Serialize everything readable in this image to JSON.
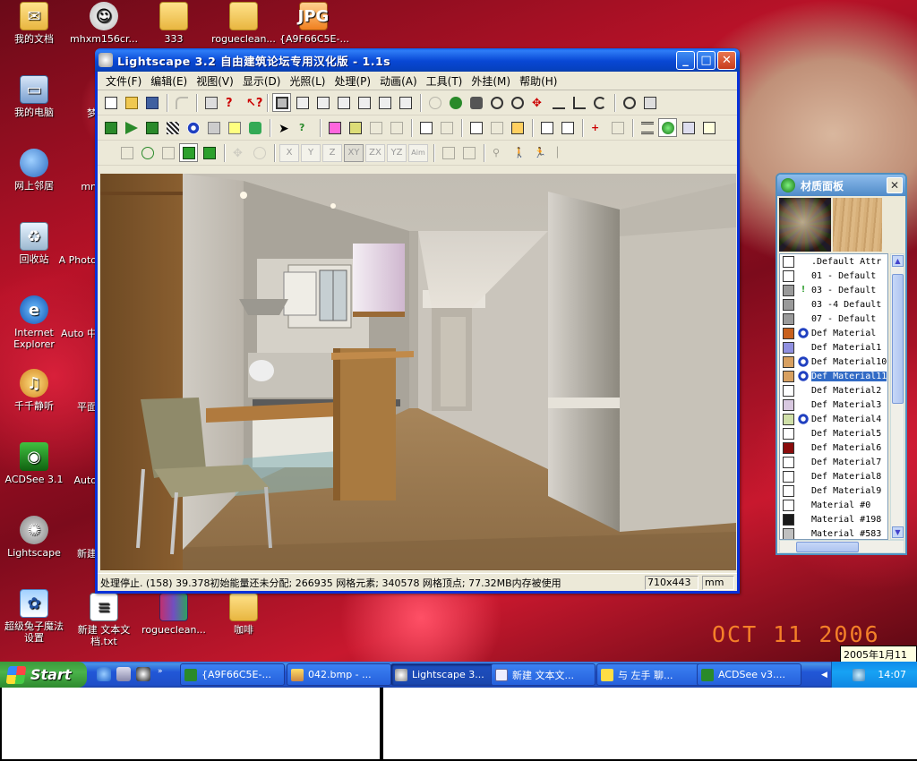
{
  "desktop": {
    "icons_left": [
      {
        "label": "我的文档",
        "icon": "my-documents-icon"
      },
      {
        "label": "我的电脑",
        "icon": "my-computer-icon"
      },
      {
        "label": "网上邻居",
        "icon": "network-places-icon"
      },
      {
        "label": "回收站",
        "icon": "recycle-bin-icon"
      },
      {
        "label": "Internet Explorer",
        "icon": "internet-explorer-icon"
      },
      {
        "label": "千千静听",
        "icon": "ttplayer-icon"
      },
      {
        "label": "ACDSee 3.1",
        "icon": "acdsee-icon"
      },
      {
        "label": "Lightscape",
        "icon": "lightscape-icon"
      },
      {
        "label": "超级兔子魔法设置",
        "icon": "rabbit-icon"
      }
    ],
    "icons_col2": [
      {
        "label": "mhxm156cr...",
        "icon": "msn-icon"
      },
      {
        "label": "梦",
        "icon": "app-icon"
      },
      {
        "label": "mn",
        "icon": "app-icon"
      },
      {
        "label": "A Photo",
        "icon": "photoshop-icon"
      },
      {
        "label": "Auto 中",
        "icon": "autocad-icon"
      },
      {
        "label": "平面",
        "icon": "app-icon"
      },
      {
        "label": "Auto",
        "icon": "autocad-icon"
      },
      {
        "label": "新建",
        "icon": "app-icon"
      },
      {
        "label": "新建 文本文档.txt",
        "icon": "text-file-icon"
      }
    ],
    "icons_top": [
      {
        "label": "333",
        "icon": "folder-icon"
      },
      {
        "label": "rogueclean...",
        "icon": "folder-icon"
      },
      {
        "label": "{A9F66C5E-...",
        "icon": "jpg-file-icon"
      }
    ],
    "icons_bottom": [
      {
        "label": "rogueclean...",
        "icon": "winrar-icon"
      },
      {
        "label": "咖啡",
        "icon": "folder-icon"
      }
    ],
    "date_stamp": "OCT 11 2006",
    "clock_tooltip": "2005年1月11日"
  },
  "main_window": {
    "title": "Lightscape 3.2 自由建筑论坛专用汉化版 - 1.1s",
    "menu": [
      "文件(F)",
      "编辑(E)",
      "视图(V)",
      "显示(D)",
      "光照(L)",
      "处理(P)",
      "动画(A)",
      "工具(T)",
      "外挂(M)",
      "帮助(H)"
    ],
    "axis_buttons": [
      "X",
      "Y",
      "Z",
      "XY",
      "ZX",
      "YZ",
      "Aim"
    ],
    "status": {
      "message": "处理停止. (158) 39.378初始能量还未分配; 266935 网格元素; 340578 网格顶点; 77.32MB内存被使用",
      "resolution": "710x443",
      "unit": "mm"
    }
  },
  "material_panel": {
    "title": "材质面板",
    "materials": [
      {
        "name": ".Default Attr",
        "color": "#ffffff",
        "mark": ""
      },
      {
        "name": "01 - Default",
        "color": "#ffffff",
        "mark": ""
      },
      {
        "name": "03 - Default",
        "color": "#9a9a9a",
        "mark": "warn"
      },
      {
        "name": "03 -4 Default",
        "color": "#9a9a9a",
        "mark": ""
      },
      {
        "name": "07 - Default",
        "color": "#9a9a9a",
        "mark": ""
      },
      {
        "name": "Def Material",
        "color": "#c8601c",
        "mark": "blue"
      },
      {
        "name": "Def Material1",
        "color": "#9090e0",
        "mark": ""
      },
      {
        "name": "Def Material10",
        "color": "#d8a060",
        "mark": "blue"
      },
      {
        "name": "Def Material11",
        "color": "#d8a060",
        "mark": "blue",
        "selected": true
      },
      {
        "name": "Def Material2",
        "color": "#ffffff",
        "mark": ""
      },
      {
        "name": "Def Material3",
        "color": "#d8c8e0",
        "mark": ""
      },
      {
        "name": "Def Material4",
        "color": "#d0e0a8",
        "mark": "blue"
      },
      {
        "name": "Def Material5",
        "color": "#ffffff",
        "mark": ""
      },
      {
        "name": "Def Material6",
        "color": "#8a0c0c",
        "mark": ""
      },
      {
        "name": "Def Material7",
        "color": "#ffffff",
        "mark": ""
      },
      {
        "name": "Def Material8",
        "color": "#ffffff",
        "mark": ""
      },
      {
        "name": "Def Material9",
        "color": "#ffffff",
        "mark": ""
      },
      {
        "name": "Material #0",
        "color": "#ffffff",
        "mark": ""
      },
      {
        "name": "Material #198",
        "color": "#1a1a1a",
        "mark": ""
      },
      {
        "name": "Material #583",
        "color": "#c0c0c0",
        "mark": ""
      }
    ]
  },
  "taskbar": {
    "start_label": "Start",
    "tasks": [
      {
        "label": "{A9F66C5E-...",
        "icon": "acdsee-icon"
      },
      {
        "label": "042.bmp - ...",
        "icon": "paint-icon"
      },
      {
        "label": "Lightscape 3...",
        "icon": "lightscape-icon",
        "active": true
      },
      {
        "label": "新建 文本文...",
        "icon": "notepad-icon"
      },
      {
        "label": "与 左手 聊...",
        "icon": "chat-icon"
      },
      {
        "label": "ACDSee v3....",
        "icon": "acdsee-icon"
      }
    ],
    "clock": "14:07"
  }
}
